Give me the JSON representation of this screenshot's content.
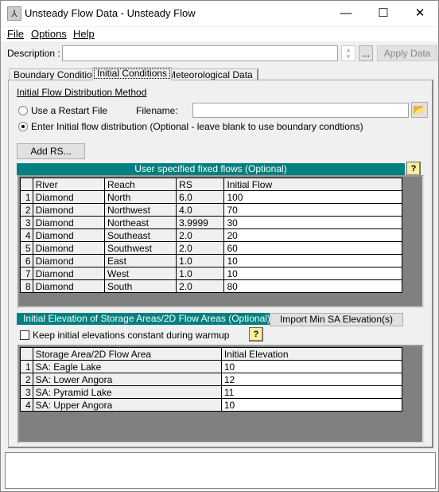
{
  "window": {
    "title": "Unsteady Flow Data - Unsteady Flow",
    "minimize": "—",
    "maximize": "☐",
    "close": "✕"
  },
  "menu": [
    {
      "label": "File"
    },
    {
      "label": "Options"
    },
    {
      "label": "Help"
    }
  ],
  "description": {
    "label": "Description :",
    "value": "",
    "browse_label": "...",
    "apply_label": "Apply Data"
  },
  "tabs": [
    {
      "label": "Boundary Conditions"
    },
    {
      "label": "Initial Conditions",
      "active": true
    },
    {
      "label": "Meteorological Data"
    }
  ],
  "initial": {
    "section_title": "Initial Flow Distribution Method",
    "restart_label": "Use a Restart File",
    "filename_label": "Filename:",
    "filename_value": "",
    "enter_label": "Enter Initial flow distribution (Optional - leave blank to use boundary condtions)",
    "selected": "enter",
    "add_rs_label": "Add RS...",
    "flows_title": "User specified fixed flows (Optional)",
    "help_label": "?",
    "flows_columns": [
      "",
      "River",
      "Reach",
      "RS",
      "Initial Flow"
    ],
    "flows_rows": [
      [
        "1",
        "Diamond",
        "North",
        "6.0",
        "100"
      ],
      [
        "2",
        "Diamond",
        "Northwest",
        "4.0",
        "70"
      ],
      [
        "3",
        "Diamond",
        "Northeast",
        "3.9999",
        "30"
      ],
      [
        "4",
        "Diamond",
        "Southeast",
        "2.0",
        "20"
      ],
      [
        "5",
        "Diamond",
        "Southwest",
        "2.0",
        "60"
      ],
      [
        "6",
        "Diamond",
        "East",
        "1.0",
        "10"
      ],
      [
        "7",
        "Diamond",
        "West",
        "1.0",
        "10"
      ],
      [
        "8",
        "Diamond",
        "South",
        "2.0",
        "80"
      ]
    ],
    "storage_title": "Initial Elevation of Storage Areas/2D Flow Areas (Optional)",
    "import_label": "Import Min SA Elevation(s)",
    "keep_label": "Keep initial elevations constant during warmup",
    "keep_checked": false,
    "storage_columns": [
      "",
      "Storage Area/2D Flow Area",
      "Initial Elevation"
    ],
    "storage_rows": [
      [
        "1",
        "SA: Eagle Lake",
        "10"
      ],
      [
        "2",
        "SA: Lower Angora",
        "12"
      ],
      [
        "3",
        "SA: Pyramid Lake",
        "11"
      ],
      [
        "4",
        "SA: Upper Angora",
        "10"
      ]
    ]
  },
  "status": {
    "text": ""
  },
  "colors": {
    "teal": "#008080",
    "grid_empty": "#808080"
  }
}
